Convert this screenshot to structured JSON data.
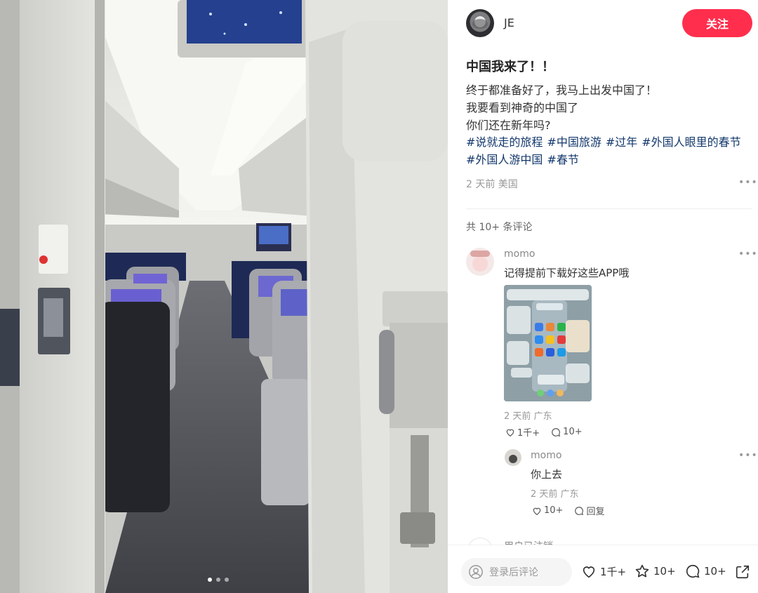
{
  "author": {
    "name": "JE",
    "follow_label": "关注"
  },
  "post": {
    "title": "中国我来了！！",
    "body_lines": [
      "终于都准备好了，我马上出发中国了！",
      "我要看到神奇的中国了",
      "你们还在新年吗?"
    ],
    "tags": [
      "#说就走的旅程",
      "#中国旅游",
      "#过年",
      "#外国人眼里的春节",
      "#外国人游中国",
      "#春节"
    ],
    "meta": "2 天前 美国",
    "image_pages": 3,
    "active_page": 1
  },
  "comments": {
    "count_label": "共 10+ 条评论",
    "items": [
      {
        "user": "momo",
        "text": "记得提前下载好这些APP哦",
        "meta": "2 天前 广东",
        "likes": "1千+",
        "replies": "10+"
      },
      {
        "user": "momo",
        "text": "你上去",
        "meta": "2 天前 广东",
        "likes": "10+",
        "reply_label": "回复"
      }
    ],
    "partial_user": "用户已注销"
  },
  "bottom_bar": {
    "comment_placeholder": "登录后评论",
    "likes": "1千+",
    "collects": "10+",
    "comments": "10+"
  },
  "colors": {
    "accent": "#ff2e4d",
    "tag": "#13386c"
  },
  "icons": [
    "more-icon",
    "heart-icon",
    "comment-icon",
    "star-icon",
    "share-icon",
    "user-icon"
  ]
}
